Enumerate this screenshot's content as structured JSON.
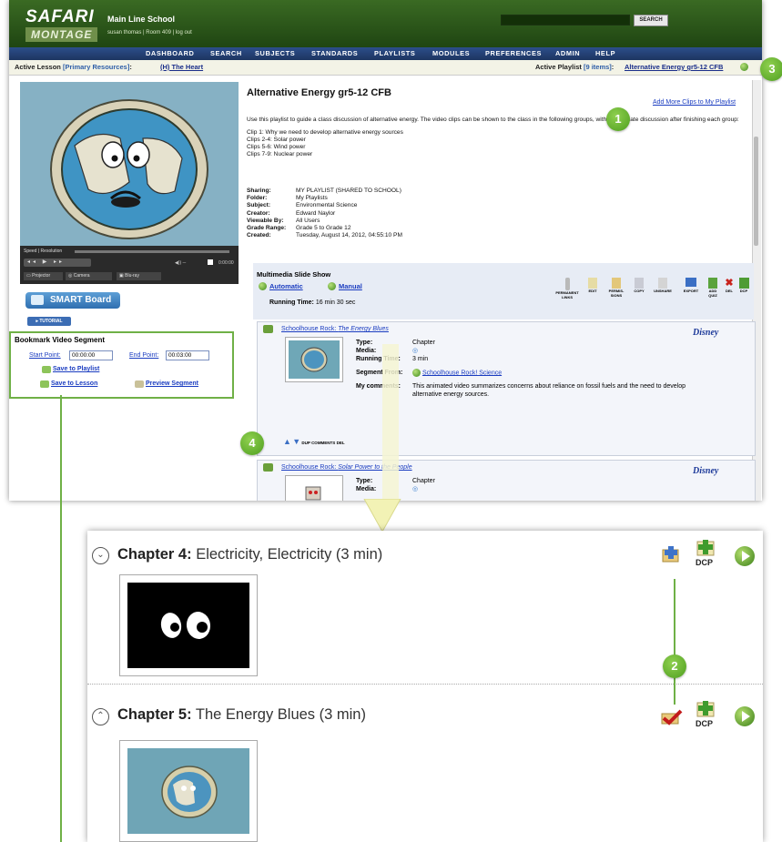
{
  "header": {
    "logo_top": "SAFARI",
    "logo_bottom": "MONTAGE",
    "school": "Main Line School",
    "user_line": "susan thomas | Room 409 | log out",
    "search_button": "SEARCH"
  },
  "nav": [
    "DASHBOARD",
    "SEARCH",
    "SUBJECTS",
    "STANDARDS",
    "PLAYLISTS",
    "MODULES",
    "PREFERENCES",
    "ADMIN",
    "HELP"
  ],
  "active_lesson": {
    "label": "Active Lesson",
    "paren": "[Primary Resources]",
    "colon": ":",
    "link": "(H) The Heart"
  },
  "active_playlist": {
    "label": "Active Playlist",
    "paren": "[9 items]",
    "colon": ":",
    "link": "Alternative Energy gr5-12 CFB"
  },
  "player": {
    "speed_label": "Speed",
    "resolution_label": "Resolution",
    "time": "0:00:00",
    "projector": "Projector",
    "camera": "Camera",
    "bluray": "Blu-ray"
  },
  "smartboard": "SMART Board",
  "tutorial": "TUTORIAL",
  "bookmark": {
    "title": "Bookmark Video Segment",
    "start_label": "Start Point:",
    "start_value": "00:00:00",
    "end_label": "End Point:",
    "end_value": "00:03:00",
    "save_playlist": "Save to Playlist",
    "save_lesson": "Save to Lesson",
    "preview": "Preview Segment"
  },
  "playlist": {
    "title": "Alternative Energy gr5-12 CFB",
    "add_more": "Add More Clips to My Playlist",
    "description": "Use this playlist to guide a class discussion of alternative energy. The video clips can be shown to the class in the following groups, with appropriate discussion after finishing each group:",
    "clips": [
      "Clip 1: Why we need to develop alternative energy sources",
      "Clips 2-4: Solar power",
      "Clips 5-6: Wind power",
      "Clips 7-9: Nuclear power"
    ],
    "meta": [
      {
        "k": "Sharing:",
        "v": "MY PLAYLIST (SHARED TO SCHOOL)"
      },
      {
        "k": "Folder:",
        "v": "My Playlists"
      },
      {
        "k": "Subject:",
        "v": "Environmental Science"
      },
      {
        "k": "Creator:",
        "v": "Edward Naylor"
      },
      {
        "k": "Viewable By:",
        "v": "All Users"
      },
      {
        "k": "Grade Range:",
        "v": "Grade 5 to Grade 12"
      },
      {
        "k": "Created:",
        "v": "Tuesday, August 14, 2012, 04:55:10 PM"
      }
    ]
  },
  "slideshow": {
    "title": "Multimedia Slide Show",
    "automatic": "Automatic",
    "manual": "Manual",
    "running_label": "Running Time:",
    "running_value": "16 min 30 sec",
    "tools": [
      "PERMANENT LINKS",
      "EDIT",
      "PERMIS-SIONS",
      "COPY",
      "UNSHARE",
      "EXPORT",
      "ADD QUIZ",
      "DEL",
      "DCP"
    ]
  },
  "clip1": {
    "title_prefix": "Schoolhouse Rock: ",
    "title_italic": "The Energy Blues",
    "type_k": "Type:",
    "type_v": "Chapter",
    "media_k": "Media:",
    "running_k": "Running Time:",
    "running_v": "3 min",
    "segment_k": "Segment From:",
    "segment_v": "Schoolhouse Rock! Science",
    "comments_k": "My comments:",
    "comments_v": "This animated video summarizes concerns about reliance on fossil fuels and the need to develop alternative energy sources.",
    "tools": [
      "DUP",
      "COMMENTS",
      "DEL"
    ],
    "brand": "Disney"
  },
  "clip2": {
    "title_prefix": "Schoolhouse Rock: ",
    "title_italic": "Solar Power to the People",
    "type_k": "Type:",
    "type_v": "Chapter",
    "media_k": "Media:",
    "brand": "Disney"
  },
  "zoom": {
    "ch4_bold": "Chapter 4:",
    "ch4_rest": " Electricity, Electricity (3 min)",
    "ch5_bold": "Chapter 5:",
    "ch5_rest": " The Energy Blues (3 min)",
    "dcp": "DCP"
  },
  "callouts": [
    "1",
    "2",
    "3",
    "4"
  ],
  "colors": {
    "brand_green": "#2f5a1c",
    "nav_blue": "#233f75",
    "callout_green": "#6bb23a",
    "link_blue": "#1a3cc0"
  }
}
